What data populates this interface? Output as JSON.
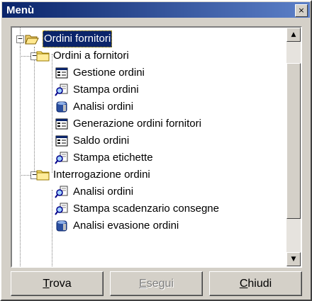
{
  "window": {
    "title": "Menù",
    "close_glyph": "×"
  },
  "tree": [
    {
      "label": "Ordini fornitori",
      "icon": "open-folder-icon",
      "level": 0,
      "expander": "−",
      "selected": true
    },
    {
      "label": "Ordini a fornitori",
      "icon": "folder-icon",
      "level": 1,
      "expander": "−"
    },
    {
      "label": "Gestione ordini",
      "icon": "form-icon",
      "level": 2
    },
    {
      "label": "Stampa ordini",
      "icon": "print-magnifier-icon",
      "level": 2
    },
    {
      "label": "Analisi ordini",
      "icon": "database-icon",
      "level": 2
    },
    {
      "label": "Generazione ordini fornitori",
      "icon": "form-icon",
      "level": 2
    },
    {
      "label": "Saldo ordini",
      "icon": "form-icon",
      "level": 2
    },
    {
      "label": "Stampa etichette",
      "icon": "print-magnifier-icon",
      "level": 2
    },
    {
      "label": "Interrogazione ordini",
      "icon": "folder-icon",
      "level": 1,
      "expander": "−"
    },
    {
      "label": "Analisi ordini",
      "icon": "print-magnifier-icon",
      "level": 2
    },
    {
      "label": "Stampa scadenzario consegne",
      "icon": "print-magnifier-icon",
      "level": 2
    },
    {
      "label": "Analisi evasione ordini",
      "icon": "database-icon",
      "level": 2
    }
  ],
  "scrollbar": {
    "up_glyph": "▲",
    "down_glyph": "▼"
  },
  "buttons": [
    {
      "key": "trova",
      "mnemonic": "T",
      "rest": "rova",
      "enabled": true
    },
    {
      "key": "esegui",
      "mnemonic": "E",
      "rest": "segui",
      "enabled": false
    },
    {
      "key": "chiudi",
      "mnemonic": "C",
      "rest": "hiudi",
      "enabled": true
    }
  ]
}
